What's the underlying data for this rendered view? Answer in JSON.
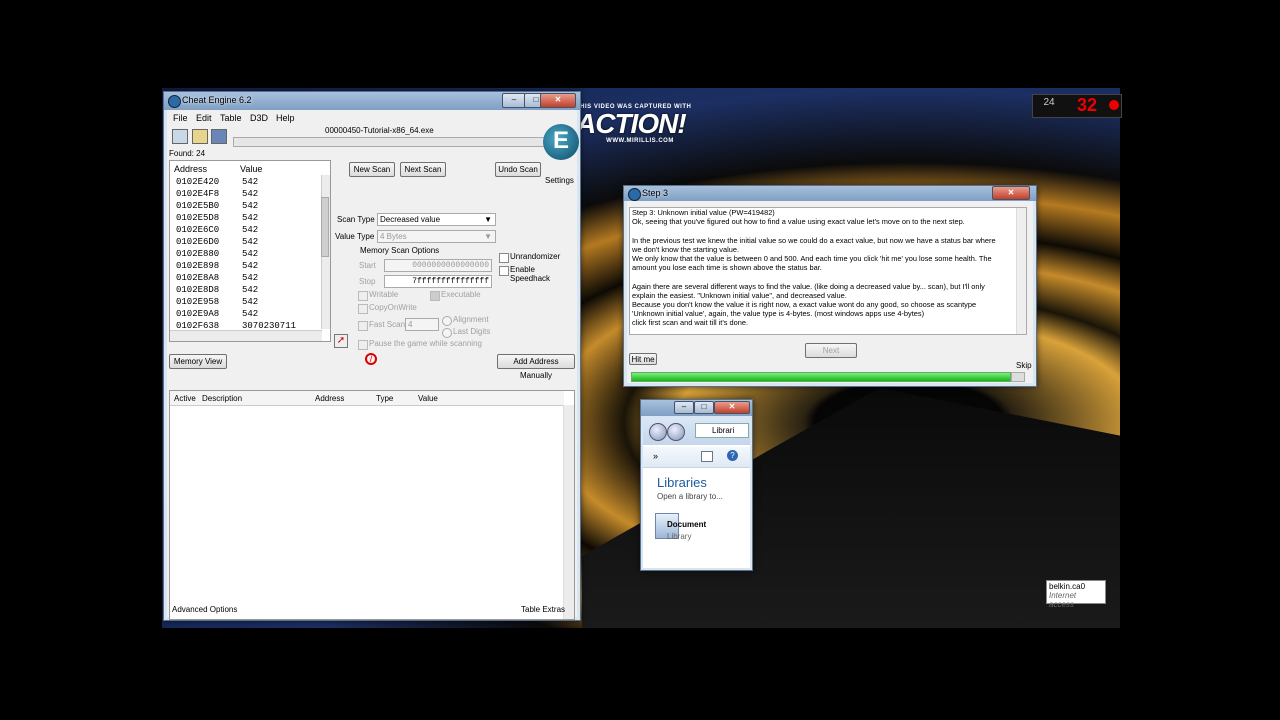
{
  "overlay": {
    "capture_text": "THIS VIDEO WAS CAPTURED WITH",
    "brand": "ACTION!",
    "url": "WWW.MIRILLIS.COM",
    "fps_label": "24",
    "fps_value": "32"
  },
  "network": {
    "name": "belkin.ca0",
    "status": "Internet access"
  },
  "ce": {
    "title": "Cheat Engine 6.2",
    "menu": [
      "File",
      "Edit",
      "Table",
      "D3D",
      "Help"
    ],
    "process": "00000450-Tutorial-x86_64.exe",
    "found": "Found: 24",
    "settings_label": "Settings",
    "columns": {
      "address": "Address",
      "value": "Value"
    },
    "results": [
      {
        "address": "0102E420",
        "value": "542"
      },
      {
        "address": "0102E4F8",
        "value": "542"
      },
      {
        "address": "0102E5B0",
        "value": "542"
      },
      {
        "address": "0102E5D8",
        "value": "542"
      },
      {
        "address": "0102E6C0",
        "value": "542"
      },
      {
        "address": "0102E6D0",
        "value": "542"
      },
      {
        "address": "0102E880",
        "value": "542"
      },
      {
        "address": "0102E898",
        "value": "542"
      },
      {
        "address": "0102E8A8",
        "value": "542"
      },
      {
        "address": "0102E8D8",
        "value": "542"
      },
      {
        "address": "0102E958",
        "value": "542"
      },
      {
        "address": "0102E9A8",
        "value": "542"
      },
      {
        "address": "0102F638",
        "value": "3070230711"
      }
    ],
    "buttons": {
      "new_scan": "New Scan",
      "next_scan": "Next Scan",
      "undo_scan": "Undo Scan",
      "memory_view": "Memory View",
      "add_address": "Add Address Manually"
    },
    "scan_type_label": "Scan Type",
    "scan_type": "Decreased value",
    "value_type_label": "Value Type",
    "value_type": "4 Bytes",
    "memory_scan_options": "Memory Scan Options",
    "start_label": "Start",
    "start_value": "0000000000000000",
    "stop_label": "Stop",
    "stop_value": "7fffffffffffffff",
    "writable": "Writable",
    "executable": "Executable",
    "copy_on_write": "CopyOnWrite",
    "fast_scan": "Fast Scan",
    "fast_scan_value": "4",
    "alignment": "Alignment",
    "last_digits": "Last Digits",
    "pause_game": "Pause the game while scanning",
    "unrandomizer": "Unrandomizer",
    "enable_speedhack": "Enable Speedhack",
    "table_columns": [
      "Active",
      "Description",
      "Address",
      "Type",
      "Value"
    ],
    "advanced_options": "Advanced Options",
    "table_extras": "Table Extras"
  },
  "step3": {
    "title": "Step 3",
    "lines": [
      "Step 3: Unknown initial value (PW=419482)",
      "Ok, seeing that you've figured out how to find a value using exact value let's move on to the next step.",
      "",
      "In the previous test we knew the initial value so we could do a exact value, but now we have a status bar where",
      "we don't know the starting value.",
      "We only know that the value is between 0 and 500. And each time you click 'hit me' you lose some health. The",
      "amount you lose each time is shown above the status bar.",
      "",
      "Again there are several different ways to find the value. (like doing a decreased value by... scan), but I'll only",
      "explain the easiest. \"Unknown initial value\", and decreased value.",
      "Because you don't know the value it is right now, a exact value wont do any good, so choose as scantype",
      "'Unknown initial value', again, the value type is 4-bytes. (most windows apps use 4-bytes)",
      "click first scan and wait till it's done."
    ],
    "next": "Next",
    "hit_me": "Hit me",
    "skip": "Skip",
    "health_fraction": 0.96
  },
  "explorer": {
    "breadcrumb": "Librari",
    "more": "»",
    "title": "Libraries",
    "subtitle": "Open a library to...",
    "item_name": "Document",
    "item_type": "Library"
  }
}
